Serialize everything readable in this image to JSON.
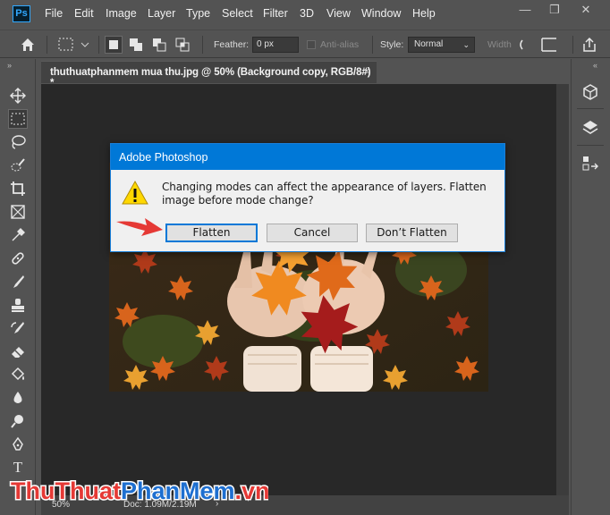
{
  "app": {
    "logo_text": "Ps",
    "menu": [
      "File",
      "Edit",
      "Image",
      "Layer",
      "Type",
      "Select",
      "Filter",
      "3D",
      "View",
      "Window",
      "Help"
    ],
    "window_controls": {
      "minimize": "—",
      "restore": "❐",
      "close": "✕"
    }
  },
  "options_bar": {
    "feather_label": "Feather:",
    "feather_value": "0 px",
    "anti_alias_label": "Anti-alias",
    "style_label": "Style:",
    "style_value": "Normal",
    "width_label": "Width"
  },
  "document": {
    "tab_title": "thuthuatphanmem mua thu.jpg @ 50% (Background copy, RGB/8#) *",
    "tab_close": "×",
    "zoom": "50%",
    "doc_info": "Doc: 1.09M/2.19M",
    "status_arrow": "›"
  },
  "dialog": {
    "title": "Adobe Photoshop",
    "message": "Changing modes can affect the appearance of layers.  Flatten image before mode change?",
    "buttons": {
      "flatten": "Flatten",
      "cancel": "Cancel",
      "dont_flatten": "Don’t Flatten"
    }
  },
  "watermark": {
    "text": "ThuThuatPhanMem.vn"
  },
  "colors": {
    "dialog_title_bg": "#0078d7",
    "default_button_border": "#0078d7",
    "warning_yellow": "#ffd800",
    "arrow_red": "#e53935"
  },
  "icons": {
    "left_tools": [
      "move-icon",
      "marquee-icon",
      "lasso-icon",
      "quick-select-icon",
      "crop-icon",
      "frame-icon",
      "eyedropper-icon",
      "healing-icon",
      "brush-icon",
      "stamp-icon",
      "history-brush-icon",
      "eraser-icon",
      "bucket-icon",
      "blur-icon",
      "dodge-icon",
      "pen-icon",
      "type-icon"
    ],
    "right_panels": [
      "3d-icon",
      "layers-icon",
      "history-icon"
    ]
  }
}
